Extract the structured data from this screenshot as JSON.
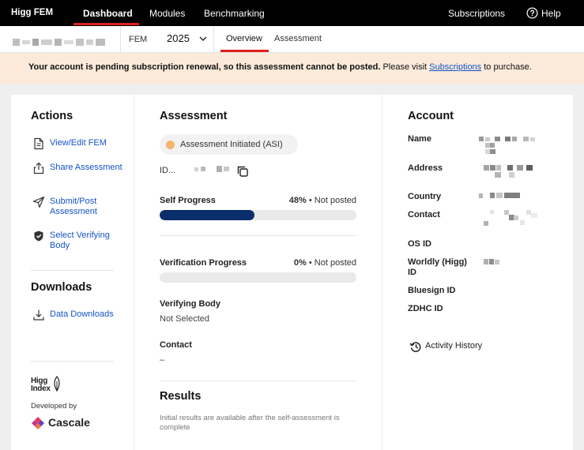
{
  "topnav": {
    "brand": "Higg FEM",
    "links": [
      "Dashboard",
      "Modules",
      "Benchmarking"
    ],
    "right": {
      "subscriptions": "Subscriptions",
      "help": "Help"
    }
  },
  "subbar": {
    "module_label": "FEM",
    "year": "2025",
    "tabs": [
      "Overview",
      "Assessment"
    ]
  },
  "banner": {
    "bold_text": "Your account is pending subscription renewal, so this assessment cannot be posted.",
    "pre_link": " Please visit ",
    "link": "Subscriptions",
    "post_link": " to purchase."
  },
  "actions": {
    "title": "Actions",
    "items": [
      {
        "label": "View/Edit FEM",
        "icon": "document-icon"
      },
      {
        "label": "Share Assessment",
        "icon": "share-icon"
      },
      {
        "label": "Submit/Post Assessment",
        "icon": "send-icon"
      },
      {
        "label": "Select Verifying Body",
        "icon": "shield-check-icon"
      }
    ],
    "downloads_title": "Downloads",
    "downloads": [
      {
        "label": "Data Downloads",
        "icon": "download-icon"
      }
    ],
    "developed_by": "Developed by",
    "higg_logo": "Higg Index",
    "cascale": "Cascale"
  },
  "assessment": {
    "title": "Assessment",
    "status": "Assessment Initiated (ASI)",
    "id_label": "ID...",
    "self_progress": {
      "label": "Self Progress",
      "percent": "48%",
      "status": "Not posted",
      "fraction": 0.48
    },
    "verification_progress": {
      "label": "Verification Progress",
      "percent": "0%",
      "status": "Not posted",
      "fraction": 0
    },
    "verifying_body": {
      "label": "Verifying Body",
      "value": "Not Selected"
    },
    "contact": {
      "label": "Contact",
      "value": "–"
    },
    "results_title": "Results",
    "results_note": "Initial results are available after the self-assessment is complete"
  },
  "account": {
    "title": "Account",
    "fields": [
      "Name",
      "Address",
      "Country",
      "Contact",
      "OS ID",
      "Worldly (Higg) ID",
      "Bluesign ID",
      "ZDHC ID"
    ],
    "activity_history": "Activity History"
  },
  "colors": {
    "accent_red": "#e0201b",
    "link_blue": "#1453c6",
    "progress_navy": "#0a2d6b",
    "banner_bg": "#fbeada",
    "status_orange": "#f5b56d"
  }
}
